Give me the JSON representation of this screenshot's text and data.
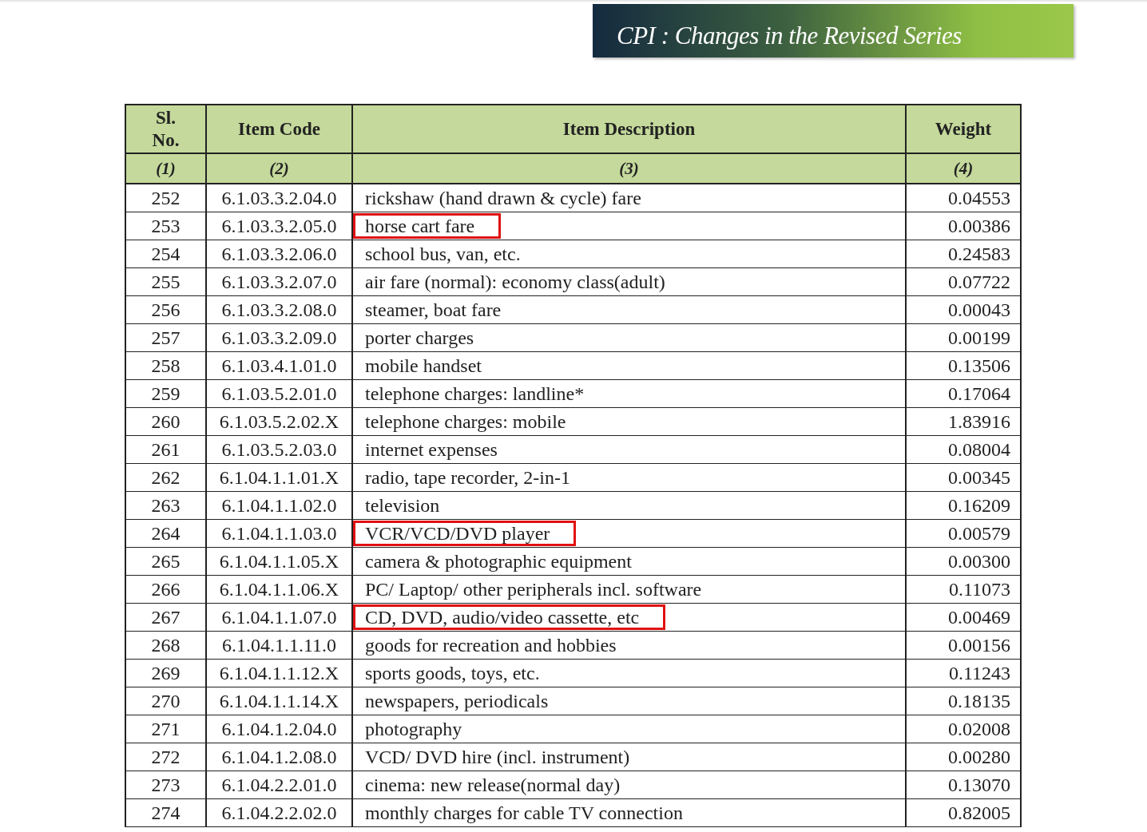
{
  "banner": {
    "title": "CPI : Changes in the Revised Series"
  },
  "table": {
    "columns": [
      {
        "label": "Sl. No.",
        "number": "(1)"
      },
      {
        "label": "Item Code",
        "number": "(2)"
      },
      {
        "label": "Item Description",
        "number": "(3)"
      },
      {
        "label": "Weight",
        "number": "(4)"
      }
    ],
    "rows": [
      {
        "sl": "252",
        "code": "6.1.03.3.2.04.0",
        "description": "rickshaw (hand drawn & cycle) fare",
        "weight": "0.04553",
        "highlighted": false
      },
      {
        "sl": "253",
        "code": "6.1.03.3.2.05.0",
        "description": "horse cart fare",
        "weight": "0.00386",
        "highlighted": true
      },
      {
        "sl": "254",
        "code": "6.1.03.3.2.06.0",
        "description": "school bus, van, etc.",
        "weight": "0.24583",
        "highlighted": false
      },
      {
        "sl": "255",
        "code": "6.1.03.3.2.07.0",
        "description": "air fare (normal): economy class(adult)",
        "weight": "0.07722",
        "highlighted": false
      },
      {
        "sl": "256",
        "code": "6.1.03.3.2.08.0",
        "description": "steamer, boat fare",
        "weight": "0.00043",
        "highlighted": false
      },
      {
        "sl": "257",
        "code": "6.1.03.3.2.09.0",
        "description": "porter charges",
        "weight": "0.00199",
        "highlighted": false
      },
      {
        "sl": "258",
        "code": "6.1.03.4.1.01.0",
        "description": "mobile handset",
        "weight": "0.13506",
        "highlighted": false
      },
      {
        "sl": "259",
        "code": "6.1.03.5.2.01.0",
        "description": "telephone charges: landline*",
        "weight": "0.17064",
        "highlighted": false
      },
      {
        "sl": "260",
        "code": "6.1.03.5.2.02.X",
        "description": "telephone charges: mobile",
        "weight": "1.83916",
        "highlighted": false
      },
      {
        "sl": "261",
        "code": "6.1.03.5.2.03.0",
        "description": "internet expenses",
        "weight": "0.08004",
        "highlighted": false
      },
      {
        "sl": "262",
        "code": "6.1.04.1.1.01.X",
        "description": "radio, tape recorder, 2-in-1",
        "weight": "0.00345",
        "highlighted": false
      },
      {
        "sl": "263",
        "code": "6.1.04.1.1.02.0",
        "description": "television",
        "weight": "0.16209",
        "highlighted": false
      },
      {
        "sl": "264",
        "code": "6.1.04.1.1.03.0",
        "description": "VCR/VCD/DVD player",
        "weight": "0.00579",
        "highlighted": true
      },
      {
        "sl": "265",
        "code": "6.1.04.1.1.05.X",
        "description": "camera & photographic equipment",
        "weight": "0.00300",
        "highlighted": false
      },
      {
        "sl": "266",
        "code": "6.1.04.1.1.06.X",
        "description": "PC/ Laptop/ other peripherals incl. software",
        "weight": "0.11073",
        "highlighted": false
      },
      {
        "sl": "267",
        "code": "6.1.04.1.1.07.0",
        "description": "CD, DVD, audio/video cassette, etc",
        "weight": "0.00469",
        "highlighted": true
      },
      {
        "sl": "268",
        "code": "6.1.04.1.1.11.0",
        "description": "goods for recreation and hobbies",
        "weight": "0.00156",
        "highlighted": false
      },
      {
        "sl": "269",
        "code": "6.1.04.1.1.12.X",
        "description": "sports goods, toys, etc.",
        "weight": "0.11243",
        "highlighted": false
      },
      {
        "sl": "270",
        "code": "6.1.04.1.1.14.X",
        "description": "newspapers, periodicals",
        "weight": "0.18135",
        "highlighted": false
      },
      {
        "sl": "271",
        "code": "6.1.04.1.2.04.0",
        "description": "photography",
        "weight": "0.02008",
        "highlighted": false
      },
      {
        "sl": "272",
        "code": "6.1.04.1.2.08.0",
        "description": "VCD/ DVD hire (incl. instrument)",
        "weight": "0.00280",
        "highlighted": false
      },
      {
        "sl": "273",
        "code": "6.1.04.2.2.01.0",
        "description": "cinema: new release(normal day)",
        "weight": "0.13070",
        "highlighted": false
      },
      {
        "sl": "274",
        "code": "6.1.04.2.2.02.0",
        "description": "monthly charges for cable TV connection",
        "weight": "0.82005",
        "highlighted": false
      }
    ]
  }
}
